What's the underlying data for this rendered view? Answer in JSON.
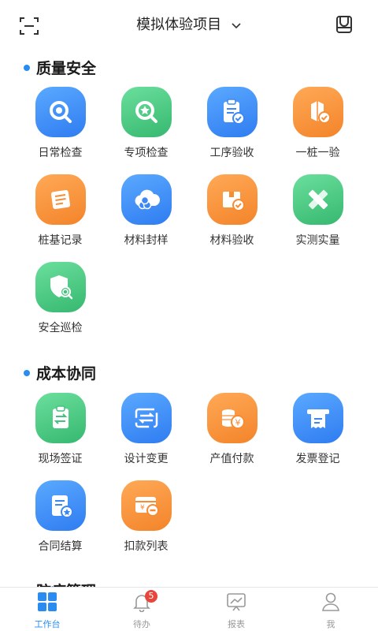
{
  "header": {
    "project_title": "模拟体验项目"
  },
  "sections": [
    {
      "title": "质量安全",
      "items": [
        {
          "label": "日常检查",
          "icon": "search-icon",
          "color": "blue"
        },
        {
          "label": "专项检查",
          "icon": "star-search-icon",
          "color": "green"
        },
        {
          "label": "工序验收",
          "icon": "clipboard-check-icon",
          "color": "blue"
        },
        {
          "label": "一桩一验",
          "icon": "pile-check-icon",
          "color": "orange"
        },
        {
          "label": "桩基记录",
          "icon": "note-icon",
          "color": "orange"
        },
        {
          "label": "材料封样",
          "icon": "material-sample-icon",
          "color": "blue"
        },
        {
          "label": "材料验收",
          "icon": "box-check-icon",
          "color": "orange"
        },
        {
          "label": "实测实量",
          "icon": "ruler-pencil-icon",
          "color": "green"
        },
        {
          "label": "安全巡检",
          "icon": "shield-search-icon",
          "color": "green"
        }
      ]
    },
    {
      "title": "成本协同",
      "items": [
        {
          "label": "现场签证",
          "icon": "transfer-doc-icon",
          "color": "green"
        },
        {
          "label": "设计变更",
          "icon": "swap-icon",
          "color": "blue"
        },
        {
          "label": "产值付款",
          "icon": "coins-icon",
          "color": "orange"
        },
        {
          "label": "发票登记",
          "icon": "invoice-icon",
          "color": "blue"
        },
        {
          "label": "合同结算",
          "icon": "contract-icon",
          "color": "blue"
        },
        {
          "label": "扣款列表",
          "icon": "deduction-card-icon",
          "color": "orange"
        }
      ]
    },
    {
      "title": "防疫管理"
    }
  ],
  "tabbar": {
    "tabs": [
      {
        "label": "工作台",
        "icon": "grid-icon",
        "active": true
      },
      {
        "label": "待办",
        "icon": "bell-icon",
        "badge": "5"
      },
      {
        "label": "报表",
        "icon": "chart-board-icon"
      },
      {
        "label": "我",
        "icon": "user-icon"
      }
    ]
  },
  "colors": {
    "accent": "#2a8cf0",
    "blue": "#3b88f5",
    "green": "#45c27e",
    "orange": "#f68d33",
    "badge": "#e8463c"
  }
}
